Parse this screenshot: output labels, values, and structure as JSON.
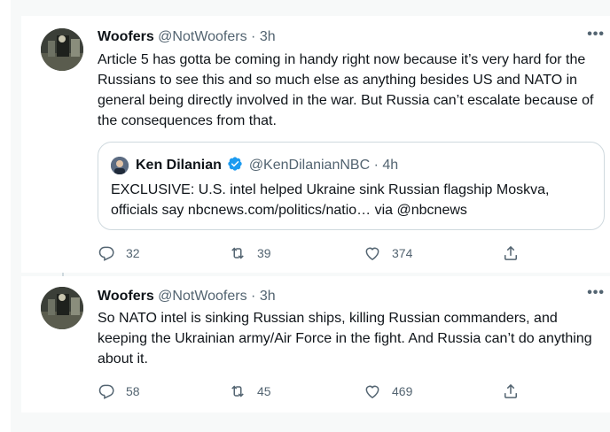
{
  "tweets": [
    {
      "name": "Woofers",
      "handle": "@NotWoofers",
      "dot": "·",
      "time": "3h",
      "more": "•••",
      "text": "Article 5 has gotta be coming in handy right now because it’s very hard for the Russians to see this and so much else as anything besides US and NATO in general being directly involved in the war. But Russia can’t escalate because of the consequences from that.",
      "quote": {
        "name": "Ken Dilanian",
        "verified": true,
        "handle": "@KenDilanianNBC",
        "dot": "·",
        "time": "4h",
        "text": "EXCLUSIVE: U.S. intel helped Ukraine sink Russian flagship Moskva, officials say nbcnews.com/politics/natio… via @nbcnews"
      },
      "replies": "32",
      "retweets": "39",
      "likes": "374"
    },
    {
      "name": "Woofers",
      "handle": "@NotWoofers",
      "dot": "·",
      "time": "3h",
      "more": "•••",
      "text": "So NATO intel is sinking Russian ships, killing Russian commanders, and keeping the Ukrainian army/Air Force in the fight. And Russia can’t do anything about it.",
      "replies": "58",
      "retweets": "45",
      "likes": "469"
    }
  ],
  "icons": {
    "reply": "reply-icon",
    "retweet": "retweet-icon",
    "like": "heart-icon",
    "share": "share-icon",
    "more": "more-icon",
    "verified": "verified-badge-icon"
  },
  "colors": {
    "text": "#0f1419",
    "secondary": "#536471",
    "border": "#cfd9de",
    "background": "#f7f9f9",
    "verified": "#1d9bf0"
  }
}
